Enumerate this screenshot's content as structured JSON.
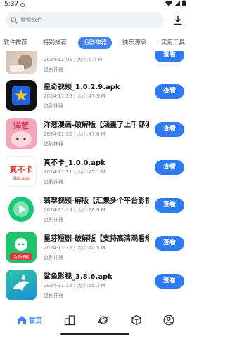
{
  "status_bar": {
    "time": "5:37"
  },
  "search": {
    "placeholder": "搜索软件"
  },
  "tabs": [
    {
      "label": "软件推荐"
    },
    {
      "label": "特别推荐"
    },
    {
      "label": "追剧神器"
    },
    {
      "label": "快乐源泉"
    },
    {
      "label": "实用工具"
    }
  ],
  "download_label": "查看",
  "items": [
    {
      "name": "",
      "date": "2024-12-05",
      "size": "大小:6.4 M",
      "category": "追剧神器"
    },
    {
      "name": "星奇视频_1.0.2.9.apk",
      "date": "2024-11-26",
      "size": "大小:47.9 M",
      "category": "追剧神器"
    },
    {
      "name": "洋葱漫画-破解版【涵盖了上千部漫",
      "date": "2024-11-22",
      "size": "大小:47.6 M",
      "category": "追剧神器",
      "icon_text": "洋葱"
    },
    {
      "name": "真不卡_1.0.0.apk",
      "date": "2024-11-21",
      "size": "大小:45.1 M",
      "category": "追剧神器",
      "icon_text": "真不卡",
      "icon_sub": "zbk.app"
    },
    {
      "name": "翡翠视频-解版【汇集多个平台影视",
      "date": "2024-11-19",
      "size": "大小:26.9 M",
      "category": "追剧神器"
    },
    {
      "name": "星芽短剧-破解版【支持高清观看短",
      "date": "2024-11-16",
      "size": "大小:40.5 M",
      "category": "追剧神器",
      "icon_text": "免费好剧"
    },
    {
      "name": "鲨鱼影视_3.8.6.apk",
      "date": "2024-11-16",
      "size": "大小:85.2 M",
      "category": "追剧神器"
    }
  ],
  "nav": {
    "home": "首页"
  },
  "colors": {
    "accent": "#3f82f6",
    "button": "#2f7bf5"
  }
}
